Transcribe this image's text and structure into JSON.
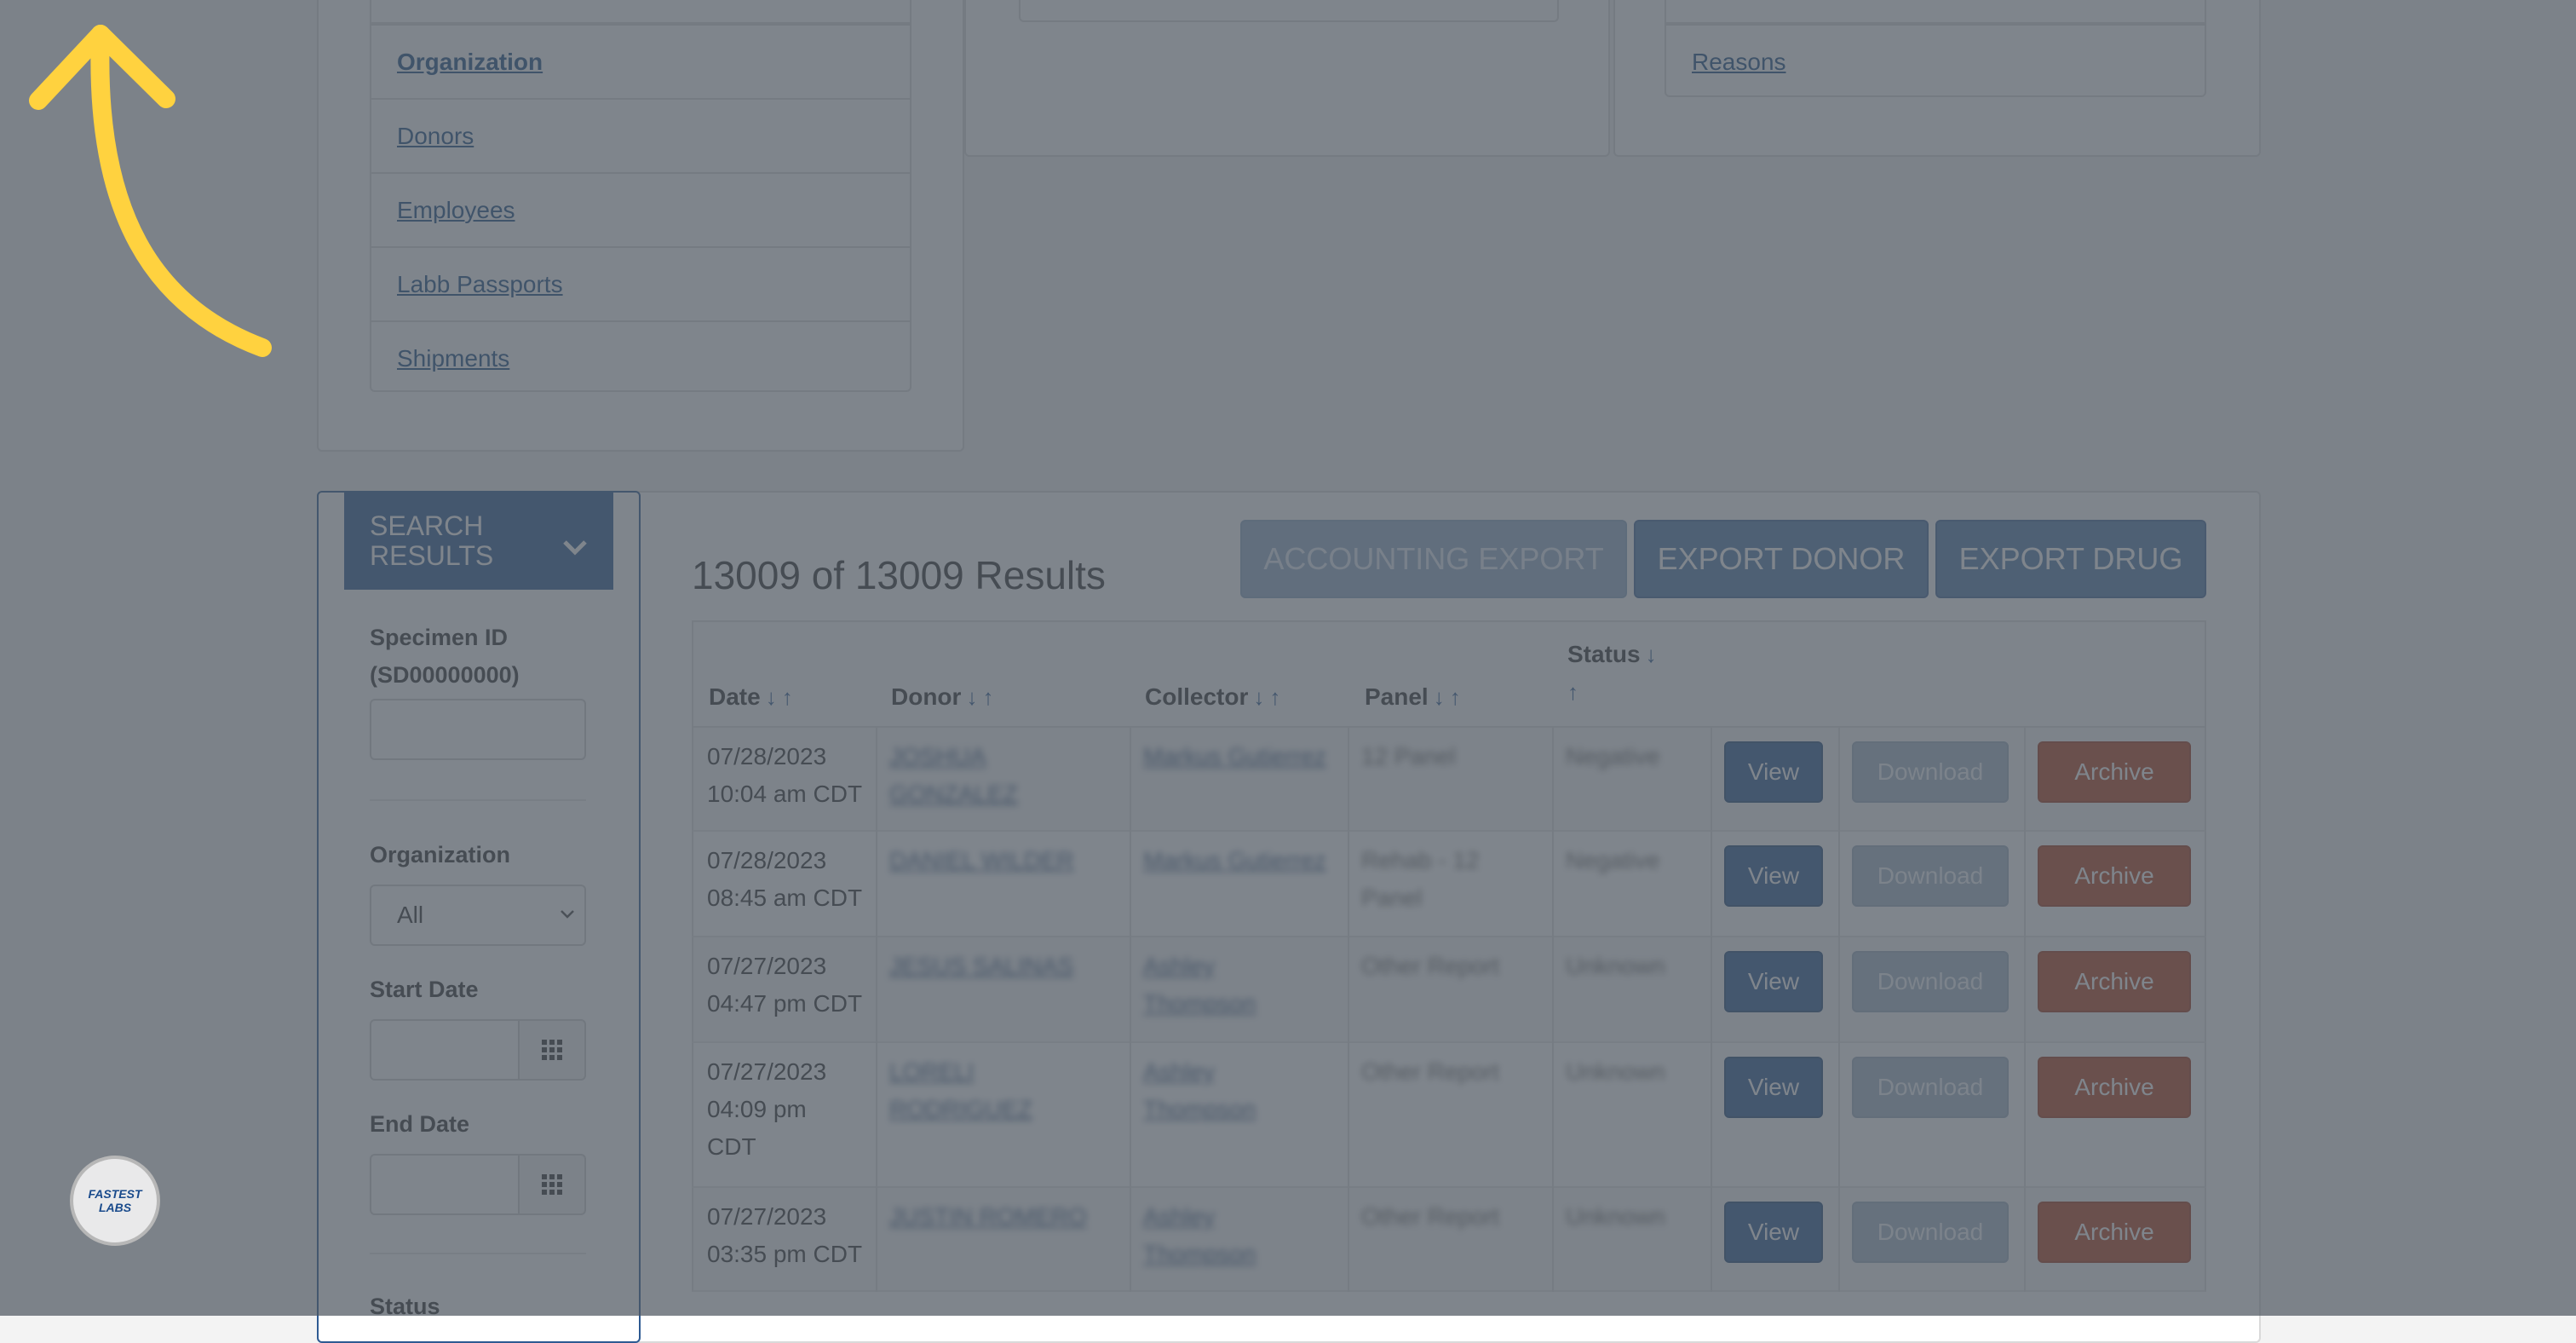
{
  "reports_links": [
    {
      "label": "Organization",
      "active": true
    },
    {
      "label": "Donors"
    },
    {
      "label": "Employees"
    },
    {
      "label": "Labb Passports"
    },
    {
      "label": "Shipments"
    }
  ],
  "right_links": [
    {
      "label": "Reasons"
    }
  ],
  "search": {
    "header": "SEARCH RESULTS",
    "specimen_label": "Specimen ID (SD00000000)",
    "specimen_value": "",
    "organization_label": "Organization",
    "organization_value": "All",
    "start_label": "Start Date",
    "end_label": "End Date",
    "status_label": "Status"
  },
  "results": {
    "title": "13009 of 13009 Results",
    "export_accounting": "ACCOUNTING EXPORT",
    "export_donor": "EXPORT DONOR",
    "export_drug": "EXPORT DRUG"
  },
  "table": {
    "columns": [
      "Date",
      "Donor",
      "Collector",
      "Panel",
      "Status"
    ],
    "sort_down": "↓",
    "sort_up": "↑",
    "rows": [
      {
        "date": [
          "07/28/2023",
          "10:04 am CDT"
        ],
        "donor": [
          "JOSHUA",
          "GONZALEZ"
        ],
        "collector": [
          "Markus Gutierrez"
        ],
        "panel": [
          "12 Panel"
        ],
        "status": "Negative"
      },
      {
        "date": [
          "07/28/2023",
          "08:45 am CDT"
        ],
        "donor": [
          "DANIEL WILDER"
        ],
        "collector": [
          "Markus Gutierrez"
        ],
        "panel": [
          "Rehab - 12",
          "Panel"
        ],
        "status": "Negative"
      },
      {
        "date": [
          "07/27/2023",
          "04:47 pm CDT"
        ],
        "donor": [
          "JESUS SALINAS"
        ],
        "collector": [
          "Ashley",
          "Thompson"
        ],
        "panel": [
          "Other Report"
        ],
        "status": "Unknown"
      },
      {
        "date": [
          "07/27/2023",
          "04:09 pm",
          "CDT"
        ],
        "donor": [
          "LORELI",
          "RODRIGUEZ"
        ],
        "collector": [
          "Ashley",
          "Thompson"
        ],
        "panel": [
          "Other Report"
        ],
        "status": "Unknown"
      },
      {
        "date": [
          "07/27/2023",
          "03:35 pm CDT"
        ],
        "donor": [
          "JUSTIN ROMERO"
        ],
        "collector": [
          "Ashley",
          "Thompson"
        ],
        "panel": [
          "Other Report"
        ],
        "status": "Unknown"
      }
    ],
    "action_view": "View",
    "action_download": "Download",
    "action_archive": "Archive"
  },
  "badge_text": "FASTEST LABS"
}
